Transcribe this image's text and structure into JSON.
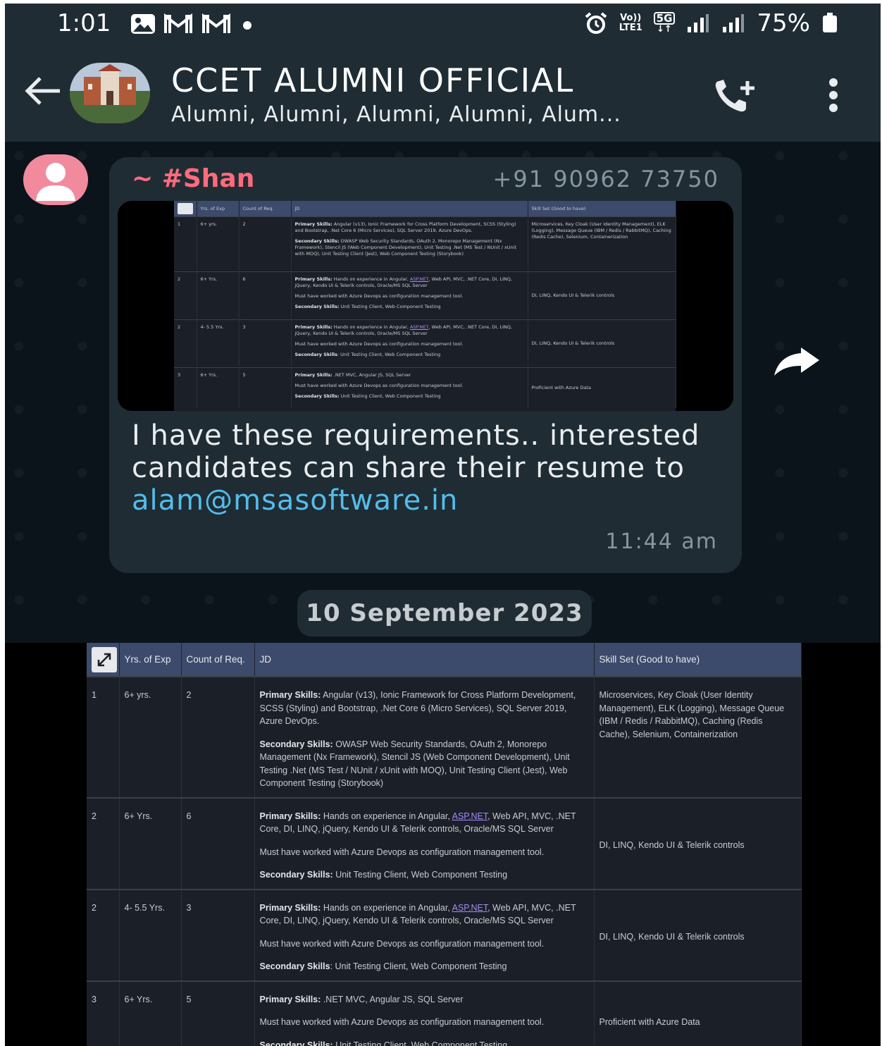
{
  "status_bar": {
    "time": "1:01",
    "volte": "Vo))",
    "lte": "LTE1",
    "network": "5G",
    "battery": "75%"
  },
  "header": {
    "title": "CCET ALUMNI OFFICIAL",
    "subtitle": "Alumni, Alumni, Alumni, Alumni, Alum..."
  },
  "message": {
    "sender": "~ #Shan",
    "phone": "+91 90962 73750",
    "text_before_link": "I have these requirements.. interested candidates can share their resume to ",
    "link": "alam@msasoftware.in",
    "time": "11:44 am"
  },
  "date_chip": "10 September 2023",
  "table": {
    "headers": [
      "Yrs. of Exp",
      "Count of Req.",
      "JD",
      "Skill Set (Good to have)"
    ],
    "rows": [
      {
        "no": "1",
        "exp": "6+ yrs.",
        "count": "2",
        "primary_label": "Primary Skills:",
        "primary": " Angular (v13), Ionic Framework for Cross Platform Development, SCSS (Styling) and Bootstrap, .Net Core 6 (Micro Services), SQL Server 2019, Azure DevOps.",
        "secondary_label": "Secondary Skills:",
        "secondary": " OWASP Web Security Standards, OAuth 2, Monorepo Management (Nx Framework), Stencil JS (Web Component Development), Unit Testing .Net (MS Test / NUnit / xUnit with MOQ), Unit Testing Client (Jest), Web Component Testing (Storybook)",
        "skill": "Microservices, Key Cloak (User Identity Management), ELK (Logging), Message Queue (IBM / Redis / RabbitMQ), Caching (Redis Cache), Selenium, Containerization"
      },
      {
        "no": "2",
        "exp": "6+ Yrs.",
        "count": "6",
        "primary_label": "Primary Skills:",
        "primary_pre": " Hands on experience in Angular, ",
        "primary_link": "ASP.NET",
        "primary_post": ", Web API, MVC, .NET Core, DI, LINQ, jQuery, Kendo UI & Telerik controls, Oracle/MS SQL Server",
        "must": "Must have worked with Azure Devops as configuration management tool.",
        "secondary_label": "Secondary Skills:",
        "secondary": " Unit Testing Client, Web Component Testing",
        "skill": "DI, LINQ, Kendo UI & Telerik controls"
      },
      {
        "no": "2",
        "exp": "4- 5.5 Yrs.",
        "count": "3",
        "primary_label": "Primary Skills:",
        "primary_pre": " Hands on experience in Angular, ",
        "primary_link": "ASP.NET",
        "primary_post": ", Web API, MVC, .NET Core, DI, LINQ, jQuery, Kendo UI & Telerik controls, Oracle/MS SQL Server",
        "must": "Must have worked with Azure Devops as configuration management tool.",
        "secondary_label": "Secondary Skills",
        "secondary": ": Unit Testing Client, Web Component Testing",
        "skill": "DI, LINQ, Kendo UI & Telerik controls"
      },
      {
        "no": "3",
        "exp": "6+ Yrs.",
        "count": "5",
        "primary_label": "Primary Skills:",
        "primary": " .NET MVC, Angular JS, SQL Server",
        "must": "Must have worked with Azure Devops as configuration management tool.",
        "secondary_label": "Secondary Skills:",
        "secondary": " Unit Testing Client, Web Component Testing",
        "skill": "Proficient with Azure Data"
      }
    ]
  },
  "colors": {
    "app_bar": "#1f2c34",
    "chat_bg": "#0b141a",
    "sender_name": "#ff6b7d",
    "link": "#53bdeb",
    "table_header": "#3c4a6b"
  },
  "icons": [
    "gallery-icon",
    "gmail-icon",
    "alarm-icon",
    "signal-icon",
    "battery-icon",
    "back-arrow-icon",
    "add-call-icon",
    "more-vert-icon",
    "person-icon",
    "forward-icon",
    "expand-icon"
  ]
}
